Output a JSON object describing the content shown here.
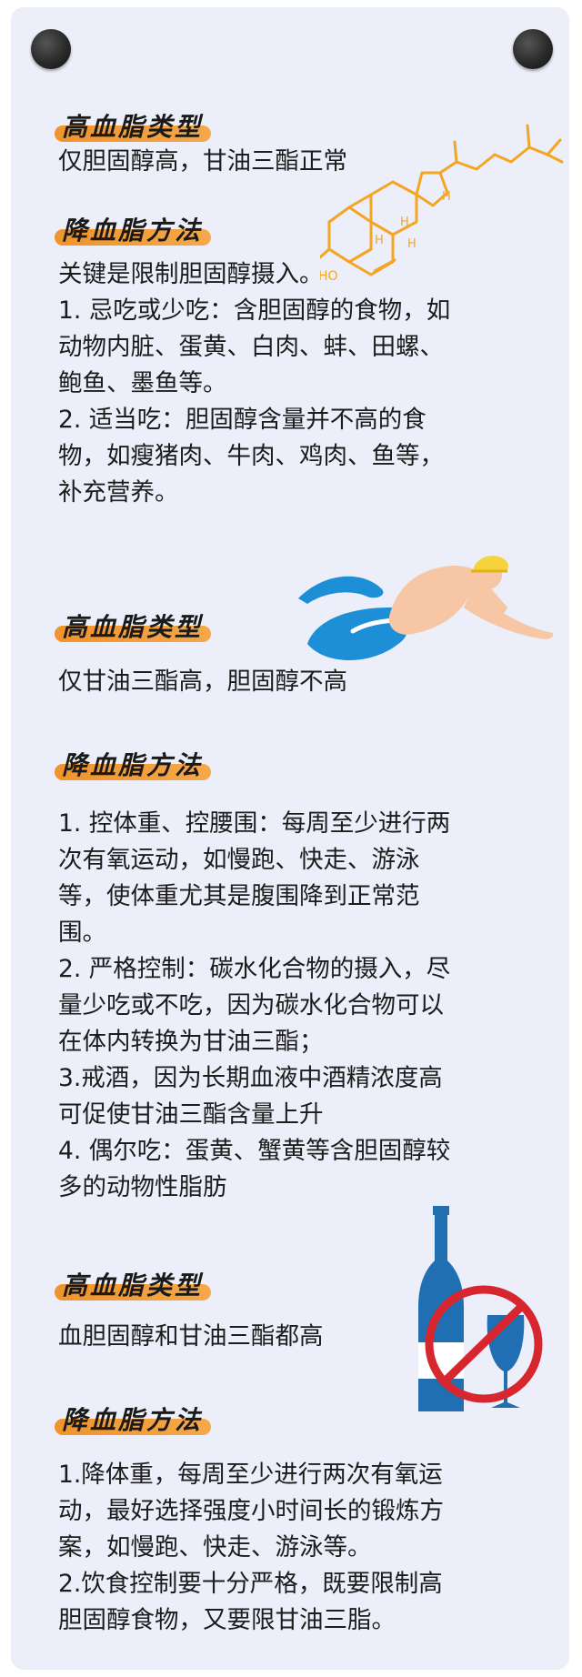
{
  "sections": [
    {
      "header": "高血脂类型",
      "lines": [
        "仅胆固醇高，甘油三酯正常"
      ]
    },
    {
      "header": "降血脂方法",
      "lines": [
        "关键是限制胆固醇摄入。",
        "1.  忌吃或少吃：含胆固醇的食物，如",
        "动物内脏、蛋黄、白肉、蚌、田螺、",
        "鲍鱼、墨鱼等。",
        "2.      适当吃：胆固醇含量并不高的食",
        "物，如瘦猪肉、牛肉、鸡肉、鱼等，",
        "补充营养。"
      ]
    },
    {
      "header": "高血脂类型",
      "lines": [
        "仅甘油三酯高，胆固醇不高"
      ]
    },
    {
      "header": "降血脂方法",
      "lines": [
        "1.  控体重、控腰围：每周至少进行两",
        "次有氧运动，如慢跑、快走、游泳",
        "等，使体重尤其是腹围降到正常范",
        "围。",
        "2.  严格控制：碳水化合物的摄入，尽",
        "量少吃或不吃，因为碳水化合物可以",
        "在体内转换为甘油三酯；",
        "3.戒酒，因为长期血液中酒精浓度高",
        "可促使甘油三酯含量上升",
        "4.  偶尔吃：蛋黄、蟹黄等含胆固醇较",
        "多的动物性脂肪"
      ]
    },
    {
      "header": "高血脂类型",
      "lines": [
        "血胆固醇和甘油三酯都高"
      ]
    },
    {
      "header": "降血脂方法",
      "lines": [
        "1.降体重，每周至少进行两次有氧运",
        "动，最好选择强度小时间长的锻炼方",
        "案，如慢跑、快走、游泳等。",
        "2.饮食控制要十分严格，既要限制高",
        "胆固醇食物，又要限甘油三脂。"
      ]
    }
  ],
  "molecule_labels": {
    "ho": "HO",
    "h": "H"
  },
  "colors": {
    "accent": "#f0932c",
    "molecule": "#f2a623",
    "water": "#1c8fd6",
    "bottle": "#1f6fb2",
    "prohibit": "#d8262e"
  }
}
